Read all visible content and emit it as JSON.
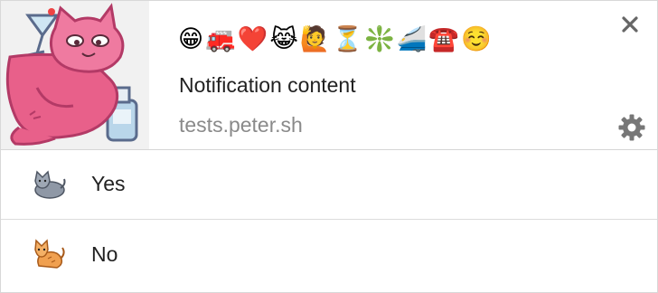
{
  "notification": {
    "emoji_line": "😁🚒❤️😹🙋⏳❇️🚄☎️☺️",
    "content": "Notification content",
    "origin": "tests.peter.sh",
    "icon": "pink-cat-sticker-icon",
    "close_icon": "close-icon",
    "settings_icon": "gear-icon"
  },
  "actions": [
    {
      "label": "Yes",
      "icon": "grey-cat-icon"
    },
    {
      "label": "No",
      "icon": "orange-cat-icon"
    }
  ],
  "colors": {
    "content_text": "#222222",
    "origin_text": "#8a8a8a",
    "divider": "#d6d6d6",
    "icon_gray": "#666666",
    "cat_pink": "#e8608a",
    "cat_orange": "#f0a050",
    "cat_grey": "#8f98a6"
  }
}
